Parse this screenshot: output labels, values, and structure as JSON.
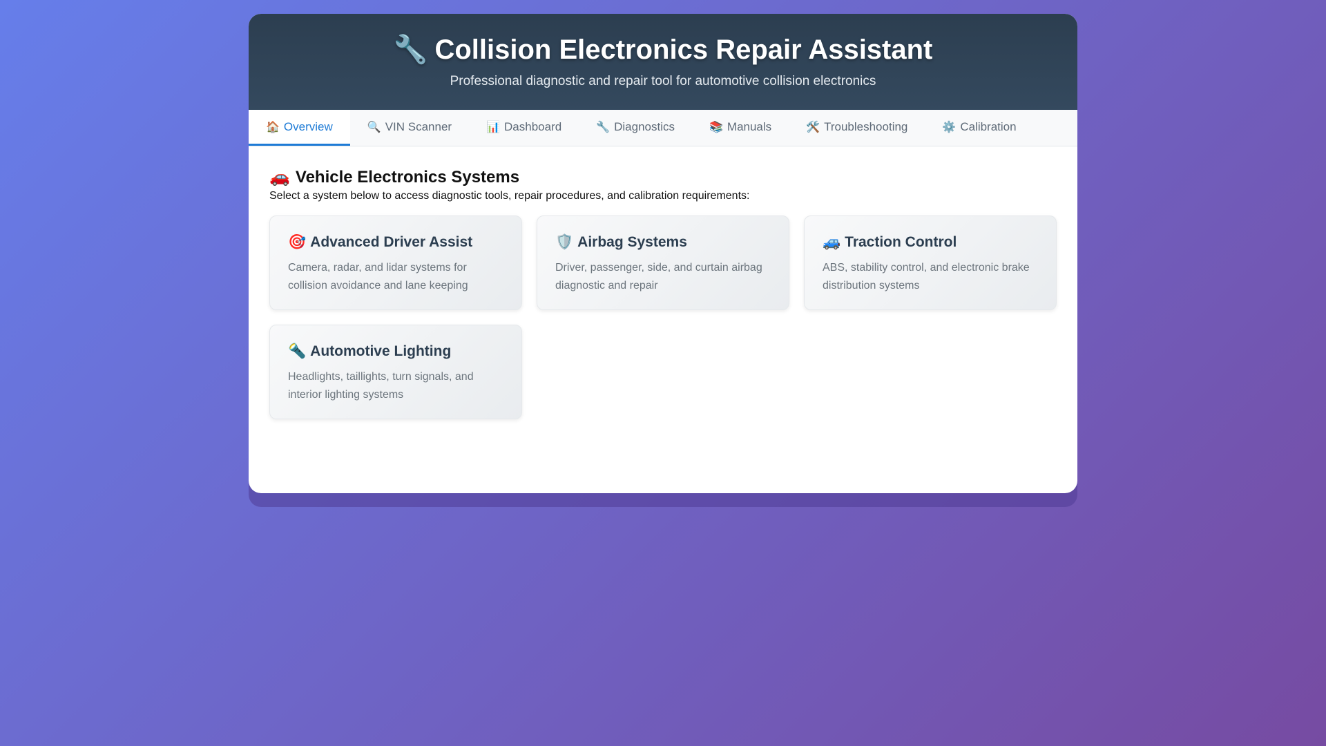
{
  "header": {
    "title_icon": "🔧",
    "title": "Collision Electronics Repair Assistant",
    "subtitle": "Professional diagnostic and repair tool for automotive collision electronics"
  },
  "tabs": [
    {
      "icon": "🏠",
      "icon_name": "home-icon",
      "label": "Overview",
      "active": true
    },
    {
      "icon": "🔍",
      "icon_name": "magnifier-icon",
      "label": "VIN Scanner",
      "active": false
    },
    {
      "icon": "📊",
      "icon_name": "bar-chart-icon",
      "label": "Dashboard",
      "active": false
    },
    {
      "icon": "🔧",
      "icon_name": "wrench-icon",
      "label": "Diagnostics",
      "active": false
    },
    {
      "icon": "📚",
      "icon_name": "books-icon",
      "label": "Manuals",
      "active": false
    },
    {
      "icon": "🛠️",
      "icon_name": "tools-icon",
      "label": "Troubleshooting",
      "active": false
    },
    {
      "icon": "⚙️",
      "icon_name": "gear-icon",
      "label": "Calibration",
      "active": false
    }
  ],
  "main": {
    "section_icon": "🚗",
    "section_title": "Vehicle Electronics Systems",
    "section_desc": "Select a system below to access diagnostic tools, repair procedures, and calibration requirements:",
    "systems": [
      {
        "icon": "🎯",
        "icon_name": "target-icon",
        "title": "Advanced Driver Assist",
        "desc": "Camera, radar, and lidar systems for collision avoidance and lane keeping"
      },
      {
        "icon": "🛡️",
        "icon_name": "shield-icon",
        "title": "Airbag Systems",
        "desc": "Driver, passenger, side, and curtain airbag diagnostic and repair"
      },
      {
        "icon": "🚙",
        "icon_name": "suv-icon",
        "title": "Traction Control",
        "desc": "ABS, stability control, and electronic brake distribution systems"
      },
      {
        "icon": "🔦",
        "icon_name": "flashlight-icon",
        "title": "Automotive Lighting",
        "desc": "Headlights, taillights, turn signals, and interior lighting systems"
      }
    ]
  },
  "colors": {
    "accent": "#1e7bd6",
    "header_bg": "#2c3e50",
    "background_start": "#667eea",
    "background_end": "#764ba2"
  }
}
